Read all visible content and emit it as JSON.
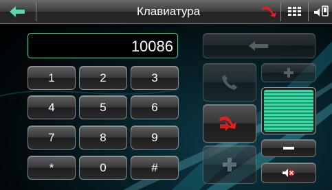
{
  "header": {
    "title": "Клавиатура"
  },
  "display": {
    "number": "10086"
  },
  "keypad": {
    "keys": [
      "1",
      "2",
      "3",
      "4",
      "5",
      "6",
      "7",
      "8",
      "9",
      "*",
      "0",
      "#"
    ]
  },
  "volume": {
    "level": 1.0
  },
  "icons": {
    "back": "arrow-left-icon",
    "hangup_status": "hang-up-icon",
    "grid": "keypad-grid-icon",
    "audio": "speaker-icon",
    "backspace": "backspace-arrow-icon",
    "call": "phone-handset-icon",
    "transfer": "call-transfer-icon",
    "add": "plus-icon",
    "volume_up": "plus-icon",
    "volume_down": "minus-icon",
    "mute": "speaker-mute-icon"
  },
  "colors": {
    "accent": "#3ad9a6",
    "danger": "#e02020"
  }
}
